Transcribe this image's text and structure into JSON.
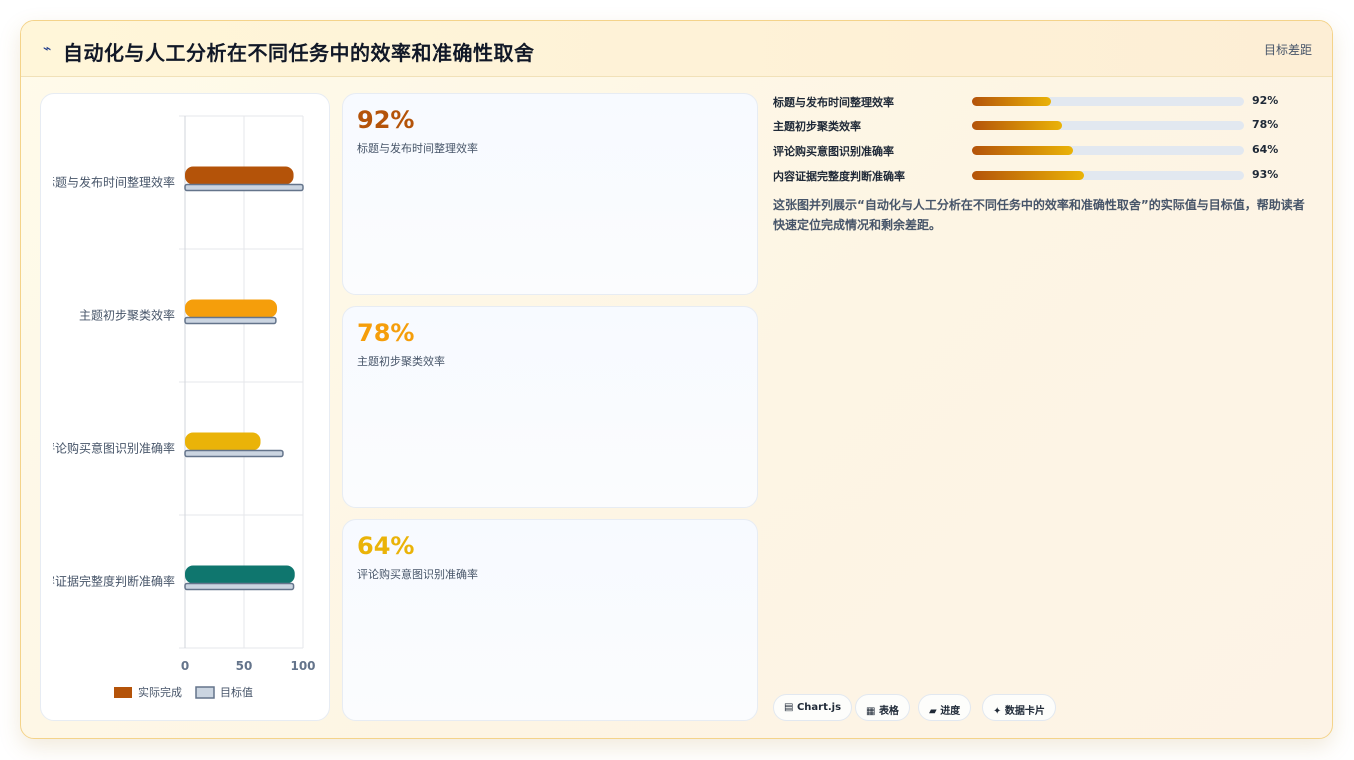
{
  "header": {
    "icon": "chart-line-icon",
    "icon_glyph": "⌁",
    "title": "自动化与人工分析在不同任务中的效率和准确性取舍",
    "badge": "目标差距"
  },
  "chart_data": {
    "type": "bar",
    "orientation": "horizontal",
    "categories": [
      "标题与发布时间整理效率",
      "主题初步聚类效率",
      "评论购买意图识别准确率",
      "内容证据完整度判断准确率"
    ],
    "series": [
      {
        "name": "实际完成",
        "values": [
          92,
          78,
          64,
          93
        ],
        "colors": [
          "#b45309",
          "#f59e0b",
          "#eab308",
          "#0f766e"
        ]
      },
      {
        "name": "目标值",
        "values": [
          100,
          77,
          83,
          92
        ],
        "color": "#cbd5e1",
        "stroke": "#64748b"
      }
    ],
    "xlim": [
      0,
      100
    ],
    "xticks": [
      "0",
      "50",
      "100"
    ],
    "grid": true,
    "legend_position": "bottom"
  },
  "kpis": [
    {
      "value": "92%",
      "label": "标题与发布时间整理效率",
      "color": "#b45309"
    },
    {
      "value": "78%",
      "label": "主题初步聚类效率",
      "color": "#f59e0b"
    },
    {
      "value": "64%",
      "label": "评论购买意图识别准确率",
      "color": "#eab308"
    }
  ],
  "progress": [
    {
      "label": "标题与发布时间整理效率",
      "value": "92%",
      "fill": 0.29
    },
    {
      "label": "主题初步聚类效率",
      "value": "78%",
      "fill": 0.33
    },
    {
      "label": "评论购买意图识别准确率",
      "value": "64%",
      "fill": 0.37
    },
    {
      "label": "内容证据完整度判断准确率",
      "value": "93%",
      "fill": 0.41
    }
  ],
  "description": "这张图并列展示“自动化与人工分析在不同任务中的效率和准确性取舍”的实际值与目标值，帮助读者快速定位完成情况和剩余差距。",
  "chips": [
    {
      "glyph": "▤",
      "label": "Chart.js"
    },
    {
      "glyph": "▦",
      "label": "表格"
    },
    {
      "glyph": "▰",
      "label": "进度"
    },
    {
      "glyph": "✦",
      "label": "数据卡片"
    }
  ]
}
